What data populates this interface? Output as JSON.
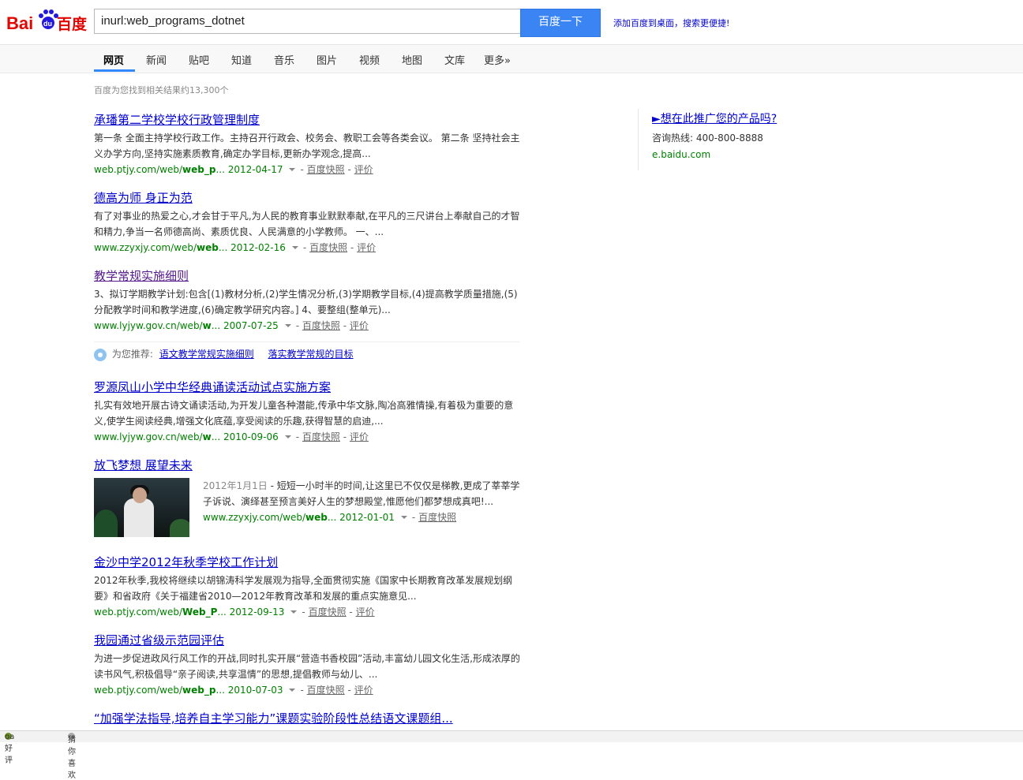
{
  "logo": {
    "text_left": "Bai",
    "text_paw": "du",
    "text_right": "百度"
  },
  "search": {
    "query": "inurl:web_programs_dotnet",
    "button_label": "百度一下"
  },
  "header_link": "添加百度到桌面，搜索更便捷!",
  "tabs": [
    {
      "label": "网页"
    },
    {
      "label": "新闻"
    },
    {
      "label": "贴吧"
    },
    {
      "label": "知道"
    },
    {
      "label": "音乐"
    },
    {
      "label": "图片"
    },
    {
      "label": "视频"
    },
    {
      "label": "地图"
    },
    {
      "label": "文库"
    },
    {
      "label": "更多»"
    }
  ],
  "result_count": "百度为您找到相关结果约13,300个",
  "snapshot_label": "百度快照",
  "rate_label": "评价",
  "results": [
    {
      "title": "承璠第二学校学校行政管理制度",
      "abstract": "第一条 全面主持学校行政工作。主持召开行政会、校务会、教职工会等各类会议。 第二条 坚持社会主义办学方向,坚持实施素质教育,确定办学目标,更新办学观念,提高...",
      "url_prefix": "web.ptjy.com/web/",
      "url_bold": "web_p",
      "url_suffix": "...",
      "date": "2012-04-17"
    },
    {
      "title": "德高为师 身正为范",
      "abstract": "有了对事业的热爱之心,才会甘于平凡,为人民的教育事业默默奉献,在平凡的三尺讲台上奉献自己的才智和精力,争当一名师德高尚、素质优良、人民满意的小学教师。 一、...",
      "url_prefix": "www.zzyxjy.com/web/",
      "url_bold": "web",
      "url_suffix": "...",
      "date": "2012-02-16"
    },
    {
      "title": "教学常规实施细则",
      "abstract": "3、拟订学期教学计划:包含[(1)教材分析,(2)学生情况分析,(3)学期教学目标,(4)提高教学质量措施,(5)分配教学时间和教学进度,(6)确定教学研究内容。] 4、要整组(整单元)...",
      "url_prefix": "www.lyjyw.gov.cn/web/",
      "url_bold": "w",
      "url_suffix": "...",
      "date": "2007-07-25"
    },
    {
      "title": "罗源凤山小学中华经典诵读活动试点实施方案",
      "abstract": "扎实有效地开展古诗文诵读活动,为开发儿童各种潜能,传承中华文脉,陶冶高雅情操,有着极为重要的意义,使学生阅读经典,增强文化底蕴,享受阅读的乐趣,获得智慧的启迪,...",
      "url_prefix": "www.lyjyw.gov.cn/web/",
      "url_bold": "w",
      "url_suffix": "...",
      "date": "2010-09-06"
    },
    {
      "title": "放飞梦想 展望未来",
      "abstract_date": "2012年1月1日",
      "abstract": " - 短短一小时半的时间,让这里已不仅仅是梯教,更成了莘莘学子诉说、演绎甚至预言美好人生的梦想殿堂,惟愿他们都梦想成真吧!...",
      "url_prefix": "www.zzyxjy.com/web/",
      "url_bold": "web",
      "url_suffix": "...",
      "date": "2012-01-01"
    },
    {
      "title": "金沙中学2012年秋季学校工作计划",
      "abstract": "2012年秋季,我校将继续以胡锦涛科学发展观为指导,全面贯彻实施《国家中长期教育改革发展规划纲要》和省政府《关于福建省2010—2012年教育改革和发展的重点实施意见...",
      "url_prefix": "web.ptjy.com/web/",
      "url_bold": "Web_P",
      "url_suffix": "...",
      "date": "2012-09-13"
    },
    {
      "title": "我园通过省级示范园评估",
      "abstract": "为进一步促进政风行风工作的开战,同时扎实开展“营造书香校园”活动,丰富幼儿园文化生活,形成浓厚的读书风气,积极倡导“亲子阅读,共享温情”的思想,提倡教师与幼儿、...",
      "url_prefix": "web.ptjy.com/web/",
      "url_bold": "web_p",
      "url_suffix": "...",
      "date": "2010-07-03"
    },
    {
      "title": "“加强学法指导,培养自主学习能力”课题实验阶段性总结语文课题组..."
    }
  ],
  "recommend": {
    "label": "为您推荐:",
    "links": [
      "语文教学常规实施细则",
      "落实教学常规的目标"
    ]
  },
  "sidebar": {
    "title": "►想在此推广您的产品吗?",
    "phone_label": "咨询热线:",
    "phone": "400-800-8888",
    "url": "e.baidu.com"
  },
  "bottom": {
    "left": "oa好评",
    "right": "猜你喜欢"
  },
  "colors": {
    "accent": "#3a85f3",
    "link": "#0000cc",
    "url_green": "#008000"
  }
}
